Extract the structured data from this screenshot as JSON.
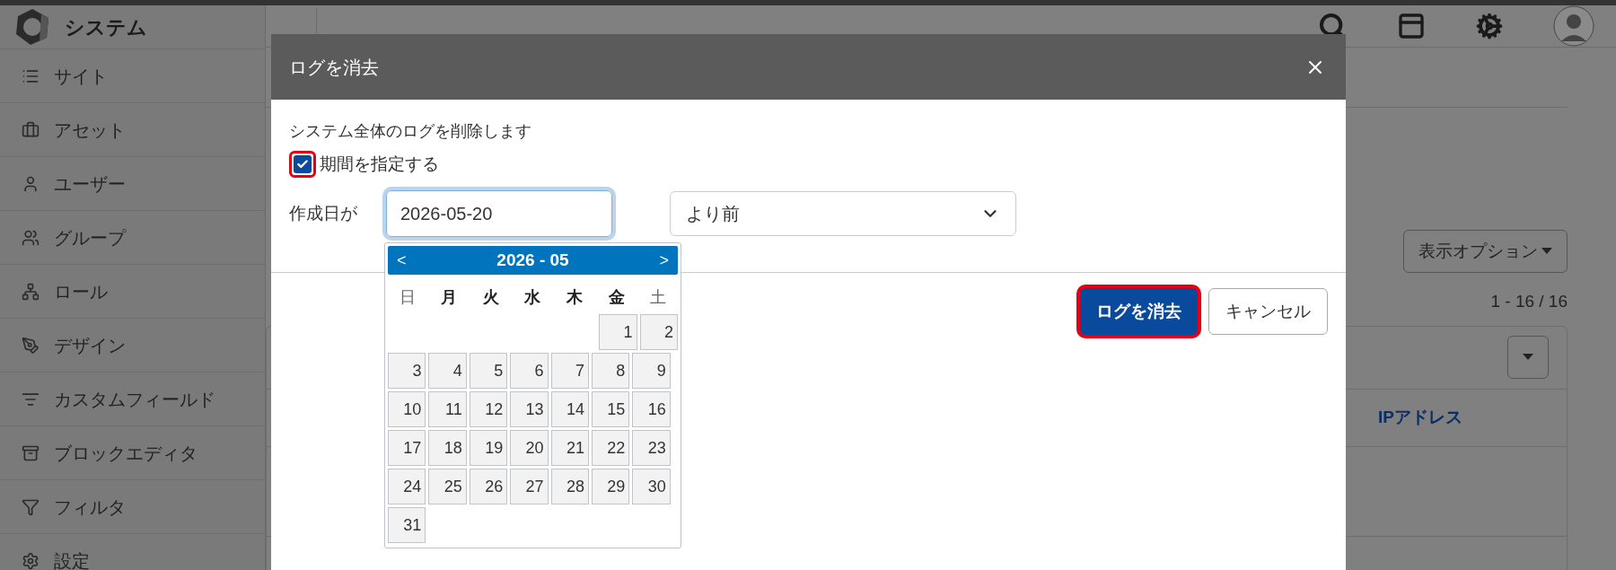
{
  "app": {
    "name": "システム"
  },
  "sidebar": {
    "items": [
      {
        "label": "サイト",
        "kind": "site"
      },
      {
        "label": "アセット",
        "kind": "asset"
      },
      {
        "label": "ユーザー",
        "kind": "user"
      },
      {
        "label": "グループ",
        "kind": "group"
      },
      {
        "label": "ロール",
        "kind": "role"
      },
      {
        "label": "デザイン",
        "kind": "design"
      },
      {
        "label": "カスタムフィールド",
        "kind": "field"
      },
      {
        "label": "ブロックエディタ",
        "kind": "block"
      },
      {
        "label": "フィルタ",
        "kind": "filter"
      },
      {
        "label": "設定",
        "kind": "settings"
      }
    ]
  },
  "content": {
    "display_options": "表示オプション",
    "pagination": "1 - 16 / 16",
    "table": {
      "columns": [
        {
          "label": "IPアドレス"
        }
      ]
    }
  },
  "dialog": {
    "title": "ログを消去",
    "description": "システム全体のログを削除します",
    "period_checkbox": {
      "label": "期間を指定する",
      "checked": true,
      "highlighted": true
    },
    "date_label": "作成日が",
    "date_field": {
      "value": "2026-05-20"
    },
    "condition_select": {
      "value": "より前"
    },
    "buttons": [
      {
        "label": "ログを消去",
        "kind": "primary",
        "highlighted": true
      },
      {
        "label": "キャンセル",
        "kind": "secondary",
        "highlighted": false
      }
    ]
  },
  "calendar": {
    "prev": "<",
    "next": ">",
    "month": "2026 - 05",
    "weekdays": [
      {
        "label": "日",
        "kind": "weekend"
      },
      {
        "label": "月",
        "kind": "weekday"
      },
      {
        "label": "火",
        "kind": "weekday"
      },
      {
        "label": "水",
        "kind": "weekday"
      },
      {
        "label": "木",
        "kind": "weekday"
      },
      {
        "label": "金",
        "kind": "weekday"
      },
      {
        "label": "土",
        "kind": "weekend"
      }
    ],
    "weeks": [
      {
        "kind": "first",
        "days": [
          "1",
          "2"
        ]
      },
      {
        "kind": "full",
        "days": [
          "3",
          "4",
          "5",
          "6",
          "7",
          "8",
          "9"
        ]
      },
      {
        "kind": "full",
        "days": [
          "10",
          "11",
          "12",
          "13",
          "14",
          "15",
          "16"
        ]
      },
      {
        "kind": "full",
        "days": [
          "17",
          "18",
          "19",
          "20",
          "21",
          "22",
          "23"
        ]
      },
      {
        "kind": "full",
        "days": [
          "24",
          "25",
          "26",
          "27",
          "28",
          "29",
          "30"
        ]
      },
      {
        "kind": "last",
        "days": [
          "31"
        ]
      }
    ]
  }
}
